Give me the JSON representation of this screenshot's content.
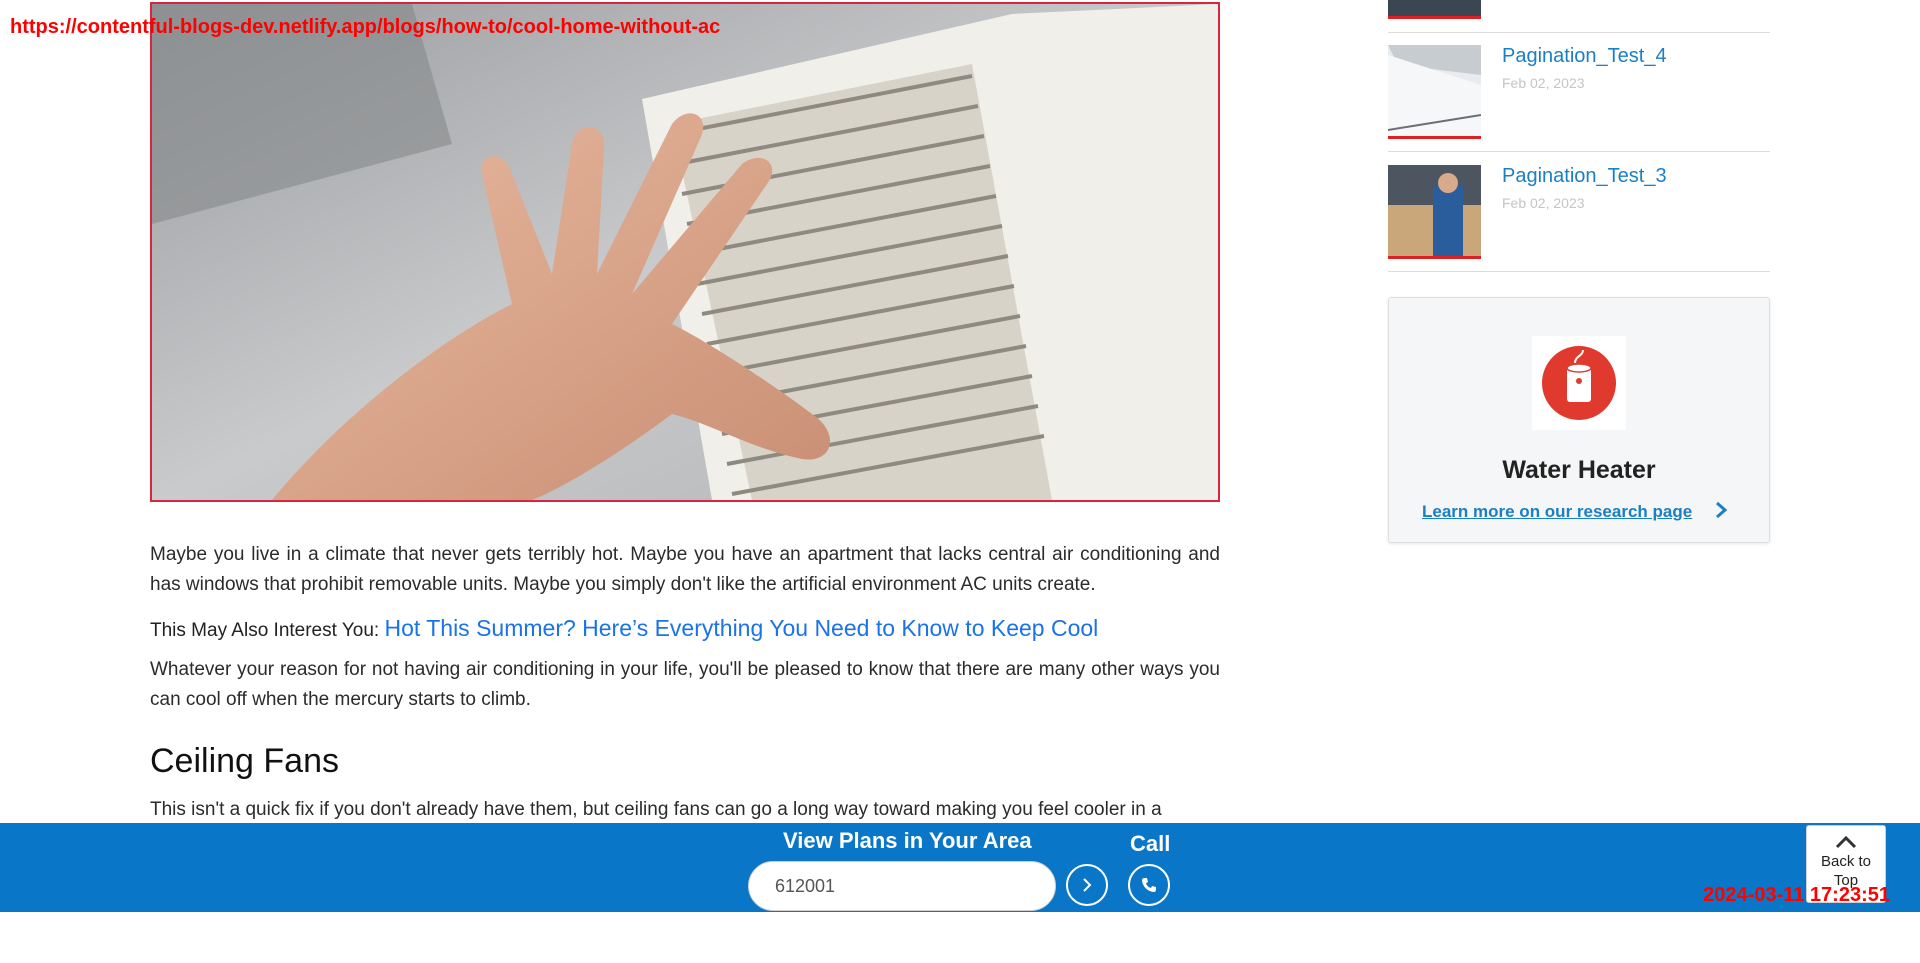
{
  "overlay": {
    "url": "https://contentful-blogs-dev.netlify.app/blogs/how-to/cool-home-without-ac",
    "timestamp": "2024-03-11 17:23:51"
  },
  "article": {
    "hero_icon": "hand-on-air-vent-photo",
    "p1": "Maybe you live in a climate that never gets terribly hot. Maybe you have an apartment that lacks central air conditioning and has windows that prohibit removable units. Maybe you simply don't like the artificial environment AC units create.",
    "interest_label": "This May Also Interest You:",
    "interest_link": "Hot This Summer? Here’s Everything You Need to Know to Keep Cool",
    "p2": "Whatever your reason for not having air conditioning in your life, you'll be pleased to know that there are many other ways you can cool off when the mercury starts to climb.",
    "h_ceiling": "Ceiling Fans",
    "p3": "This isn't a quick fix if you don't already have them, but ceiling fans can go a long way toward making you feel cooler in a"
  },
  "sidebar": {
    "posts": [
      {
        "title": "Pagination_Test_4",
        "date": "Feb 02, 2023"
      },
      {
        "title": "Pagination_Test_3",
        "date": "Feb 02, 2023"
      }
    ],
    "promo": {
      "icon": "water-heater-icon",
      "title": "Water Heater",
      "link": "Learn more on our research page"
    }
  },
  "bottom_bar": {
    "heading": "View Plans in Your Area",
    "zip_value": "612001",
    "call_label": "Call",
    "back_to_top": "Back to Top"
  },
  "colors": {
    "bar_blue": "#0a76c7",
    "link_blue": "#1a73e8",
    "sidebar_blue": "#1a7fc6",
    "accent_red": "#e02020"
  }
}
